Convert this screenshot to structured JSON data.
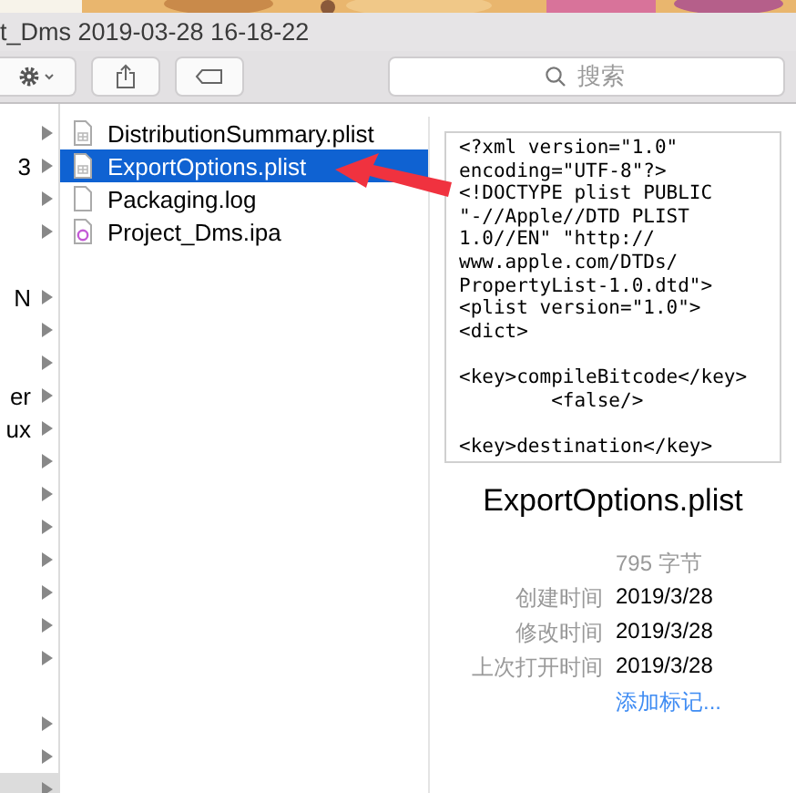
{
  "window": {
    "title": "t_Dms 2019-03-28 16-18-22"
  },
  "toolbar": {
    "search": {
      "placeholder": "搜索"
    }
  },
  "column_1": {
    "items": [
      {
        "kind": "folder",
        "selected": false
      },
      {
        "kind": "folder",
        "label": "3",
        "selected": false
      },
      {
        "kind": "folder",
        "selected": false
      },
      {
        "kind": "folder",
        "selected": false
      },
      {
        "kind": "blank"
      },
      {
        "kind": "folder",
        "label": "N",
        "selected": false
      },
      {
        "kind": "folder",
        "selected": false
      },
      {
        "kind": "folder",
        "selected": false
      },
      {
        "kind": "folder",
        "label": "er",
        "selected": false
      },
      {
        "kind": "folder",
        "label": "ux",
        "selected": false
      },
      {
        "kind": "folder",
        "selected": false
      },
      {
        "kind": "folder",
        "selected": false
      },
      {
        "kind": "folder",
        "selected": false
      },
      {
        "kind": "folder",
        "selected": false
      },
      {
        "kind": "folder",
        "selected": false
      },
      {
        "kind": "folder",
        "selected": false
      },
      {
        "kind": "folder",
        "selected": false
      },
      {
        "kind": "blank"
      },
      {
        "kind": "folder",
        "selected": false
      },
      {
        "kind": "folder",
        "selected": false
      },
      {
        "kind": "folder",
        "selected": true
      }
    ]
  },
  "column_2": {
    "items": [
      {
        "name": "DistributionSummary.plist",
        "kind": "plist",
        "selected": false
      },
      {
        "name": "ExportOptions.plist",
        "kind": "plist",
        "selected": true
      },
      {
        "name": "Packaging.log",
        "kind": "log",
        "selected": false
      },
      {
        "name": "Project_Dms.ipa",
        "kind": "ipa",
        "selected": false
      }
    ]
  },
  "preview": {
    "content": "<?xml version=\"1.0\"\nencoding=\"UTF-8\"?>\n<!DOCTYPE plist PUBLIC\n\"-//Apple//DTD PLIST\n1.0//EN\" \"http://\nwww.apple.com/DTDs/\nPropertyList-1.0.dtd\">\n<plist version=\"1.0\">\n<dict>\n\n<key>compileBitcode</key>\n        <false/>\n\n<key>destination</key>",
    "filename": "ExportOptions.plist",
    "size": "795 字节",
    "info": [
      {
        "label": "创建时间",
        "value": "2019/3/28"
      },
      {
        "label": "修改时间",
        "value": "2019/3/28"
      },
      {
        "label": "上次打开时间",
        "value": "2019/3/28"
      }
    ],
    "add_tags": "添加标记..."
  }
}
